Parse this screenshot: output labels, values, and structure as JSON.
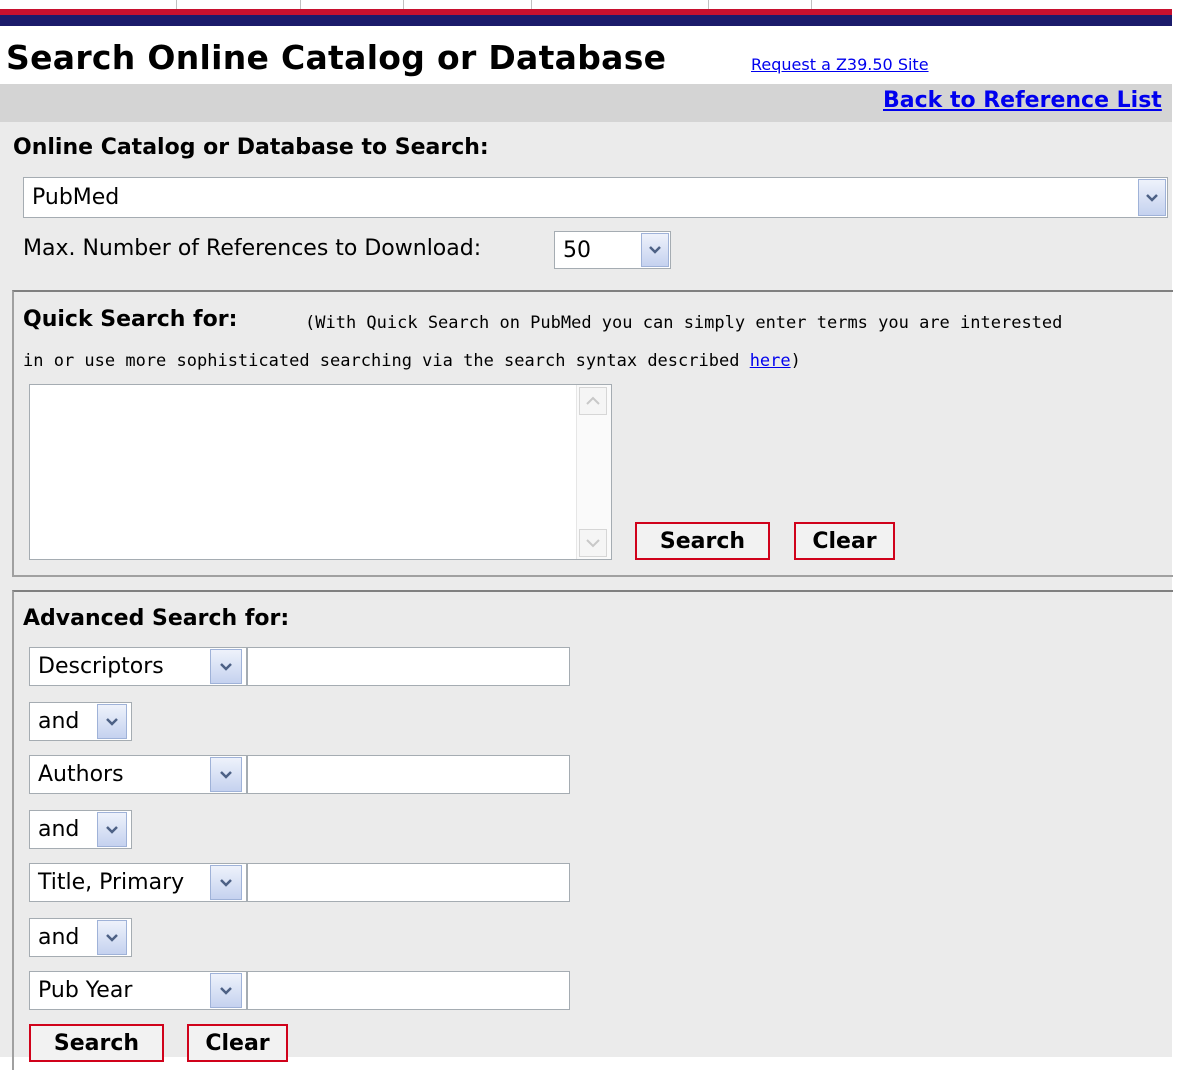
{
  "page": {
    "title": "Search Online Catalog or Database",
    "z3950_link": "Request a Z39.50 Site",
    "back_link": "Back to Reference List"
  },
  "catalog": {
    "label": "Online Catalog or Database to Search:",
    "selected": "PubMed"
  },
  "max_refs": {
    "label": "Max. Number of References to Download:",
    "selected": "50"
  },
  "quick_search": {
    "label": "Quick Search for:",
    "description_line1": "(With Quick Search on PubMed you can simply enter terms you are interested",
    "description_line2_prefix": "in or use more sophisticated searching via the search syntax described ",
    "description_link": "here",
    "description_line2_suffix": ")",
    "query": "",
    "search_label": "Search",
    "clear_label": "Clear"
  },
  "advanced_search": {
    "label": "Advanced Search for:",
    "rows": [
      {
        "field": "Descriptors",
        "value": ""
      },
      {
        "operator": "and"
      },
      {
        "field": "Authors",
        "value": ""
      },
      {
        "operator": "and"
      },
      {
        "field": "Title, Primary",
        "value": ""
      },
      {
        "operator": "and"
      },
      {
        "field": "Pub Year",
        "value": ""
      }
    ],
    "search_label": "Search",
    "clear_label": "Clear"
  },
  "icons": {
    "dropdown": "chevron-down-icon",
    "scroll_up": "scroll-up-icon",
    "scroll_down": "scroll-down-icon"
  },
  "colors": {
    "header_red": "#c8102e",
    "header_navy": "#1b1b6b",
    "link_blue": "#0000ee",
    "button_border": "#d0021b",
    "panel_bg": "#ebebeb"
  }
}
